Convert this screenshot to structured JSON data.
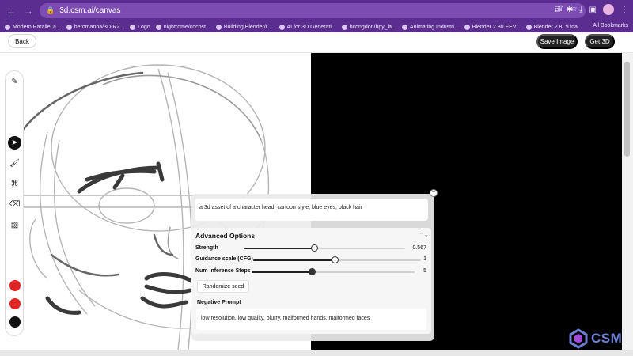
{
  "browser": {
    "url": "3d.csm.ai/canvas",
    "bookmarks": [
      "Modern Parallel a...",
      "heromanba/3D-R2...",
      "Logo",
      "nightrome/cocost...",
      "Building Blender/L...",
      "AI for 3D Generati...",
      "bcongdon/bpy_la...",
      "Animating Industri...",
      "Blender 2.80 EEV...",
      "Blender 2.8: *Una..."
    ],
    "all_bookmarks": "All Bookmarks"
  },
  "header": {
    "back_label": "Back",
    "save_label": "Save Image",
    "get3d_label": "Get 3D"
  },
  "toolbar": {
    "tools": [
      "brush-cleanup-icon",
      "pointer-icon",
      "brush-icon",
      "shapes-icon",
      "eraser-icon",
      "image-icon"
    ],
    "active_tool": "pointer-icon",
    "colors": [
      "#e02424",
      "#e02424",
      "#111111"
    ]
  },
  "panel": {
    "prompt": "a 3d asset of a character head, cartoon style, blue eyes, black hair",
    "advanced_title": "Advanced Options",
    "sliders": [
      {
        "label": "Strength",
        "value": "0.567",
        "fraction": 0.44
      },
      {
        "label": "Guidance scale (CFG)",
        "value": "1",
        "fraction": 0.49
      },
      {
        "label": "Num Inference Steps",
        "value": "5",
        "fraction": 0.37
      }
    ],
    "randomize_label": "Randomize seed",
    "negative_label": "Negative Prompt",
    "negative_prompt": "low resolution, low quality, blurry, malformed hands, malformed faces"
  },
  "logo_text": "CSM"
}
